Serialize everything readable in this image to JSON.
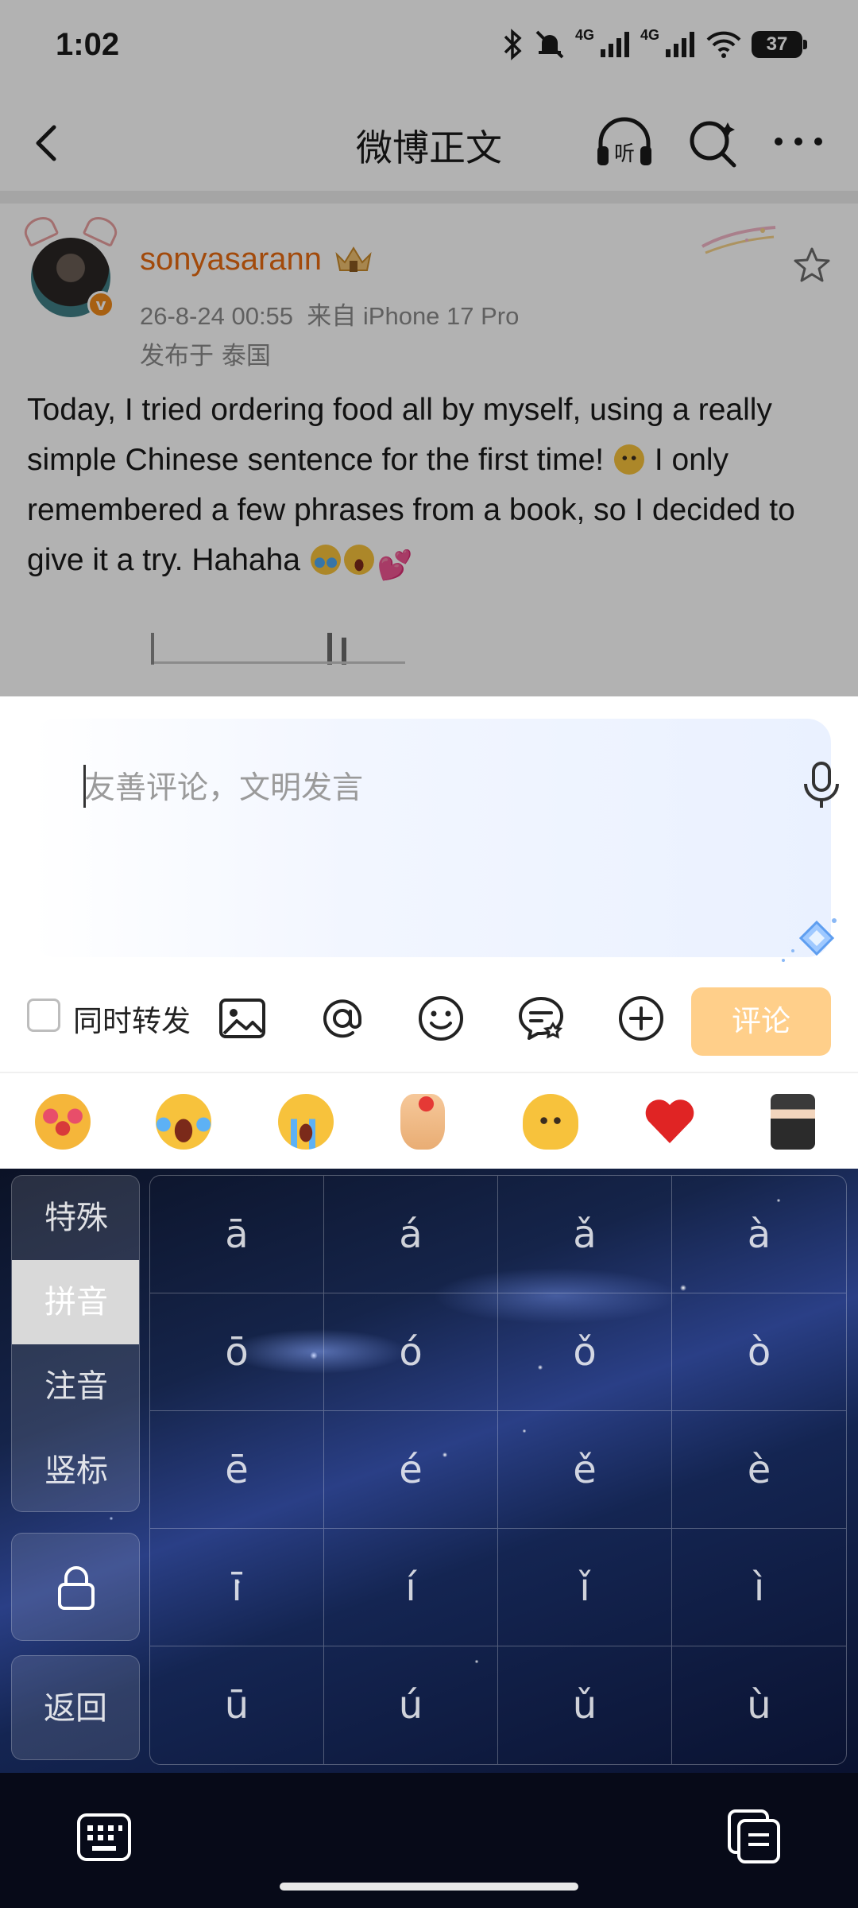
{
  "status_bar": {
    "time": "1:02",
    "network_1": "4G",
    "network_2": "4G",
    "battery": "37"
  },
  "nav": {
    "title": "微博正文",
    "listen_label": "听"
  },
  "post": {
    "username": "sonyasarann",
    "verified_badge": "v",
    "timestamp": "26-8-24 00:55",
    "source": "来自 iPhone 17 Pro",
    "location": "发布于 泰国",
    "text_part1": "Today, I tried ordering food all by myself, using a really simple Chinese sentence for the first time!",
    "text_part2": "I only remembered a few phrases from a book, so I decided to give it a try. Hahaha",
    "hearts_glyph": "💕"
  },
  "composer": {
    "placeholder": "友善评论，文明发言",
    "repost_label": "同时转发",
    "repost_checked": false,
    "submit_label": "评论",
    "submit_color": "#ffcf8a"
  },
  "toolbar_icons": [
    "image-icon",
    "at-icon",
    "emoji-icon",
    "chat-icon",
    "plus-icon"
  ],
  "quick_emojis": [
    "hug-face",
    "tears-of-joy",
    "loudly-crying",
    "finger-heart",
    "melting-face",
    "red-heart",
    "sticker-avatar"
  ],
  "keyboard": {
    "side_tabs": [
      "特殊",
      "拼音",
      "注音",
      "竖标"
    ],
    "active_tab": "拼音",
    "back_label": "返回",
    "keys": [
      [
        "ā",
        "á",
        "ǎ",
        "à"
      ],
      [
        "ō",
        "ó",
        "ǒ",
        "ò"
      ],
      [
        "ē",
        "é",
        "ě",
        "è"
      ],
      [
        "ī",
        "í",
        "ǐ",
        "ì"
      ],
      [
        "ū",
        "ú",
        "ǔ",
        "ù"
      ]
    ]
  },
  "colors": {
    "username": "#e86a10",
    "accent_orange": "#f08a1a"
  }
}
